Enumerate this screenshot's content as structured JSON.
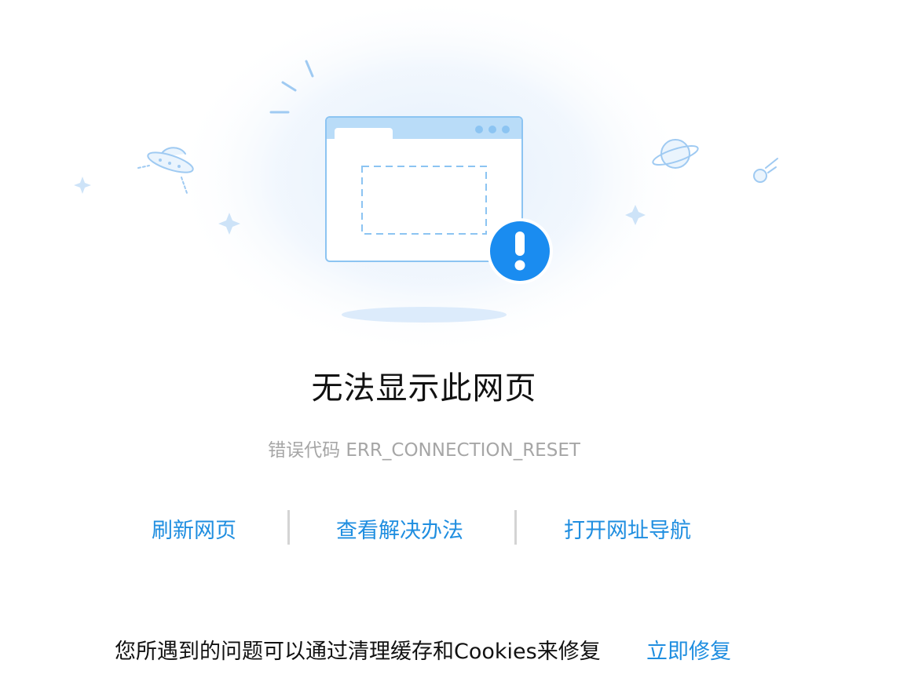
{
  "error_page": {
    "title": "无法显示此网页",
    "error_code_text": "错误代码 ERR_CONNECTION_RESET"
  },
  "actions": [
    {
      "label": "刷新网页"
    },
    {
      "label": "查看解决办法"
    },
    {
      "label": "打开网址导航"
    }
  ],
  "fix": {
    "message": "您所遇到的问题可以通过清理缓存和Cookies来修复",
    "link_label": "立即修复"
  },
  "colors": {
    "accent": "#1f8ee0",
    "alert": "#1a8cf0",
    "text_primary": "#111111",
    "text_secondary": "#a6a6a6",
    "separator": "#d4d4d4"
  },
  "icons": {
    "main": "browser-window-error-icon",
    "alert": "exclamation-circle-icon",
    "ufo": "ufo-icon",
    "planet": "planet-icon",
    "meteor": "meteor-icon",
    "sparkle": "sparkle-icon"
  }
}
